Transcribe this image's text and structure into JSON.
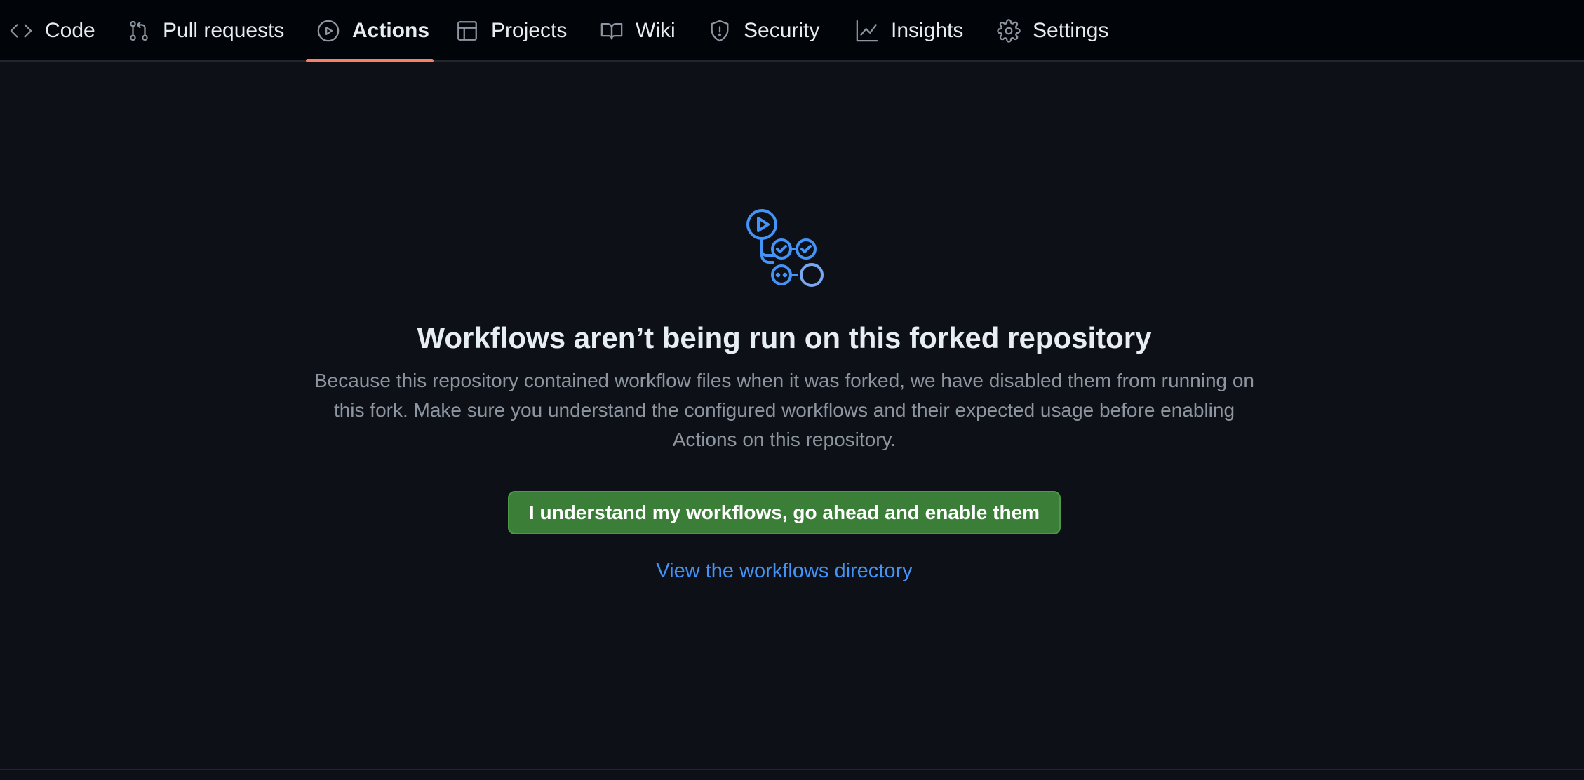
{
  "nav": {
    "tabs": [
      {
        "label": "Code",
        "icon": "code-icon"
      },
      {
        "label": "Pull requests",
        "icon": "git-pull-request-icon"
      },
      {
        "label": "Actions",
        "icon": "play-circle-icon",
        "active": true
      },
      {
        "label": "Projects",
        "icon": "table-icon"
      },
      {
        "label": "Wiki",
        "icon": "book-icon"
      },
      {
        "label": "Security",
        "icon": "shield-icon"
      },
      {
        "label": "Insights",
        "icon": "graph-icon"
      },
      {
        "label": "Settings",
        "icon": "gear-icon"
      }
    ],
    "active_underline_color": "#f78166"
  },
  "main": {
    "icon": "workflow-icon",
    "title": "Workflows aren’t being run on this forked repository",
    "description": "Because this repository contained workflow files when it was forked, we have disabled them from running on this fork. Make sure you understand the configured workflows and their expected usage before enabling Actions on this repository.",
    "enable_button": "I understand my workflows, go ahead and enable them",
    "directory_link": "View the workflows directory"
  },
  "colors": {
    "background": "#0d1117",
    "nav_background": "#010409",
    "button_green": "#3a7e37",
    "link_blue": "#4493f8",
    "icon_blue": "#4493f8"
  }
}
